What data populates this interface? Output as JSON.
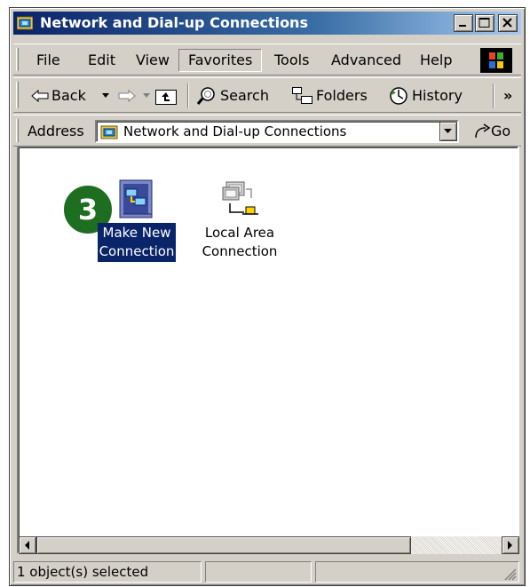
{
  "window": {
    "title": "Network and Dial-up Connections",
    "icon": "folder-network-icon"
  },
  "menubar": {
    "items": [
      "File",
      "Edit",
      "View",
      "Favorites",
      "Tools",
      "Advanced",
      "Help"
    ]
  },
  "toolbar": {
    "back_label": "Back",
    "search_label": "Search",
    "folders_label": "Folders",
    "history_label": "History",
    "overflow_glyph": "»"
  },
  "address": {
    "label": "Address",
    "value": "Network and Dial-up Connections",
    "go_label": "Go"
  },
  "content": {
    "step_badge": "3",
    "items": [
      {
        "label_line1": "Make New",
        "label_line2": "Connection",
        "icon": "make-new-connection-icon",
        "selected": true
      },
      {
        "label_line1": "Local Area",
        "label_line2": "Connection",
        "icon": "local-area-connection-icon",
        "selected": false
      }
    ]
  },
  "status": {
    "text": "1 object(s) selected"
  },
  "colors": {
    "selection": "#0a246a",
    "badge": "#1e6e22",
    "face": "#d4d0c8"
  }
}
